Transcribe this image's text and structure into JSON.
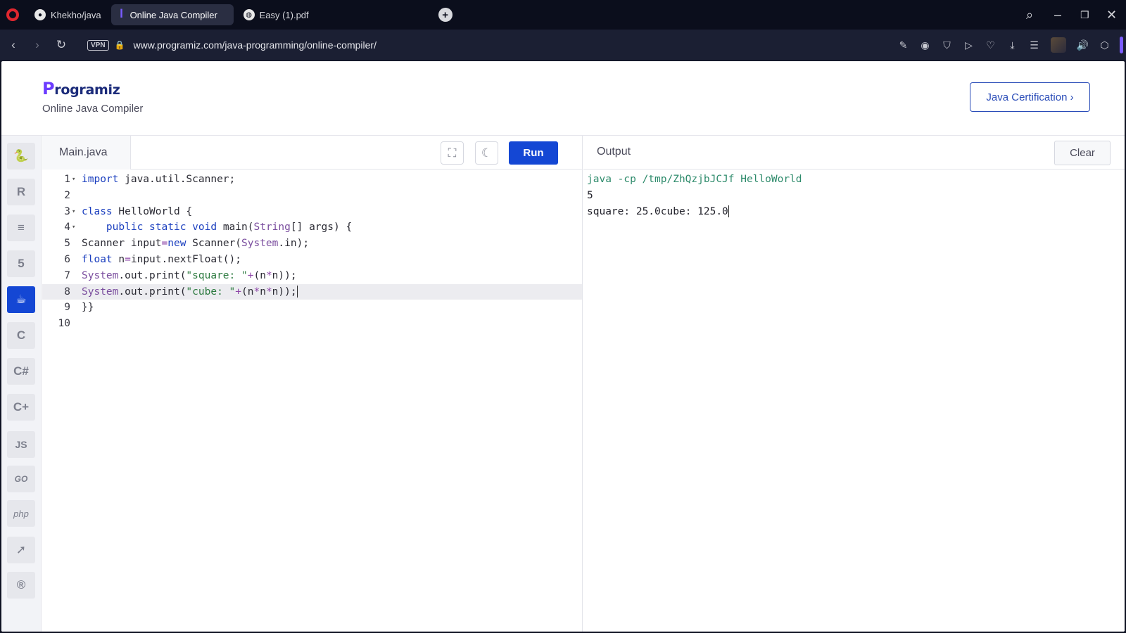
{
  "browser": {
    "tabs": [
      {
        "title": "Khekho/java",
        "icon": "github-icon"
      },
      {
        "title": "Online Java Compiler",
        "icon": "programiz-icon",
        "active": true
      },
      {
        "title": "Easy (1).pdf",
        "icon": "globe-icon"
      }
    ],
    "vpn_label": "VPN",
    "url": "www.programiz.com/java-programming/online-compiler/"
  },
  "site": {
    "logo_initial": "P",
    "logo_rest": "rogramiz",
    "subtitle": "Online Java Compiler",
    "cert_button": "Java Certification ›"
  },
  "languages": [
    {
      "name": "python",
      "label": "🐍"
    },
    {
      "name": "r",
      "label": "R"
    },
    {
      "name": "sql",
      "label": "≡"
    },
    {
      "name": "html",
      "label": "5"
    },
    {
      "name": "java",
      "label": "☕",
      "active": true
    },
    {
      "name": "c",
      "label": "C"
    },
    {
      "name": "csharp",
      "label": "C#"
    },
    {
      "name": "cpp",
      "label": "C+"
    },
    {
      "name": "javascript",
      "label": "JS"
    },
    {
      "name": "go",
      "label": "GO"
    },
    {
      "name": "php",
      "label": "php"
    },
    {
      "name": "swift",
      "label": "➚"
    },
    {
      "name": "rust",
      "label": "®"
    }
  ],
  "editor": {
    "filename": "Main.java",
    "run_label": "Run",
    "lines": [
      {
        "n": "1",
        "fold": true
      },
      {
        "n": "2"
      },
      {
        "n": "3",
        "fold": true
      },
      {
        "n": "4",
        "fold": true
      },
      {
        "n": "5"
      },
      {
        "n": "6"
      },
      {
        "n": "7"
      },
      {
        "n": "8",
        "highlight": true
      },
      {
        "n": "9"
      },
      {
        "n": "10"
      }
    ]
  },
  "output": {
    "title": "Output",
    "clear_label": "Clear",
    "lines": [
      "java -cp /tmp/ZhQzjbJCJf HelloWorld",
      "5",
      "square: 25.0cube: 125.0"
    ]
  },
  "colors": {
    "accent": "#1447d4",
    "keyword": "#1b3fbf",
    "string": "#2c7a3f"
  }
}
